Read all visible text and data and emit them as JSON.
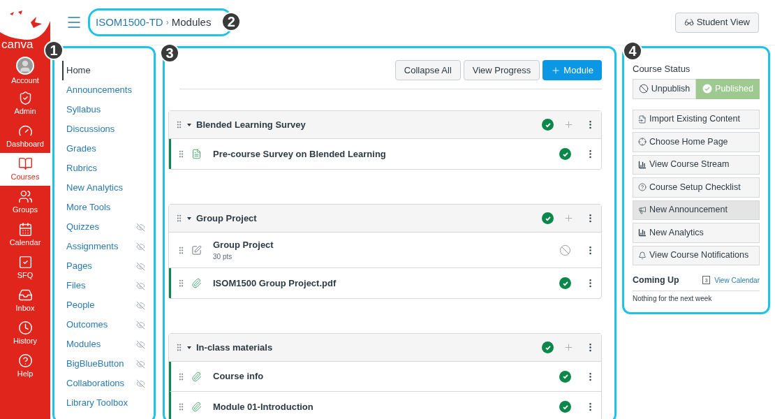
{
  "header": {
    "breadcrumb": [
      {
        "label": "ISOM1500-TD",
        "kind": "link"
      },
      {
        "label": "Modules",
        "kind": "current"
      }
    ],
    "separator": "›",
    "student_view": "Student View"
  },
  "global_nav": {
    "logo_text": "canva",
    "items": [
      {
        "label": "Account",
        "selected": false
      },
      {
        "label": "Admin",
        "selected": false
      },
      {
        "label": "Dashboard",
        "selected": false
      },
      {
        "label": "Courses",
        "selected": true
      },
      {
        "label": "Groups",
        "selected": false
      },
      {
        "label": "Calendar",
        "selected": false
      },
      {
        "label": "SFQ",
        "selected": false
      },
      {
        "label": "Inbox",
        "selected": false
      },
      {
        "label": "History",
        "selected": false
      },
      {
        "label": "Help",
        "selected": false
      }
    ]
  },
  "course_nav": [
    {
      "label": "Home",
      "selected": true,
      "hidden": false
    },
    {
      "label": "Announcements",
      "selected": false,
      "hidden": false
    },
    {
      "label": "Syllabus",
      "selected": false,
      "hidden": false
    },
    {
      "label": "Discussions",
      "selected": false,
      "hidden": false
    },
    {
      "label": "Grades",
      "selected": false,
      "hidden": false
    },
    {
      "label": "Rubrics",
      "selected": false,
      "hidden": false
    },
    {
      "label": "New Analytics",
      "selected": false,
      "hidden": false
    },
    {
      "label": "More Tools",
      "selected": false,
      "hidden": false
    },
    {
      "label": "Quizzes",
      "selected": false,
      "hidden": true
    },
    {
      "label": "Assignments",
      "selected": false,
      "hidden": true
    },
    {
      "label": "Pages",
      "selected": false,
      "hidden": true
    },
    {
      "label": "Files",
      "selected": false,
      "hidden": true
    },
    {
      "label": "People",
      "selected": false,
      "hidden": true
    },
    {
      "label": "Outcomes",
      "selected": false,
      "hidden": true
    },
    {
      "label": "Modules",
      "selected": false,
      "hidden": true
    },
    {
      "label": "BigBlueButton",
      "selected": false,
      "hidden": true
    },
    {
      "label": "Collaborations",
      "selected": false,
      "hidden": true
    },
    {
      "label": "Library Toolbox",
      "selected": false,
      "hidden": false
    }
  ],
  "toolbar": [
    {
      "label": "Collapse All",
      "kind": "secondary"
    },
    {
      "label": "View Progress",
      "kind": "secondary"
    },
    {
      "label": "Module",
      "kind": "primary"
    }
  ],
  "modules": [
    {
      "title": "Blended Learning Survey",
      "published": true,
      "expanded": true,
      "items": [
        {
          "title": "Pre-course Survey on Blended Learning",
          "kind": "page",
          "published": true
        }
      ]
    },
    {
      "title": "Group Project",
      "published": true,
      "expanded": true,
      "items": [
        {
          "title": "Group Project",
          "kind": "assignment",
          "points": "30 pts",
          "published": false
        },
        {
          "title": "ISOM1500 Group Project.pdf",
          "kind": "file",
          "published": true
        }
      ]
    },
    {
      "title": "In-class materials",
      "published": true,
      "expanded": true,
      "items": [
        {
          "title": "Course info",
          "kind": "file",
          "published": true
        },
        {
          "title": "Module 01-Introduction",
          "kind": "file",
          "published": true
        }
      ]
    }
  ],
  "sidebar": {
    "heading": "Course Status",
    "status": [
      {
        "label": "Unpublish",
        "selected": false
      },
      {
        "label": "Published",
        "selected": true
      }
    ],
    "actions": [
      {
        "label": "Import Existing Content",
        "hovered": false
      },
      {
        "label": "Choose Home Page",
        "hovered": false
      },
      {
        "label": "View Course Stream",
        "hovered": false
      },
      {
        "label": "Course Setup Checklist",
        "hovered": false
      },
      {
        "label": "New Announcement",
        "hovered": true
      },
      {
        "label": "New Analytics",
        "hovered": false
      },
      {
        "label": "View Course Notifications",
        "hovered": false
      }
    ],
    "coming_up": {
      "title": "Coming Up",
      "calendar_day": "3",
      "link": "View Calendar",
      "empty": "Nothing for the next week"
    }
  },
  "callouts": [
    "1",
    "2",
    "3",
    "4"
  ]
}
